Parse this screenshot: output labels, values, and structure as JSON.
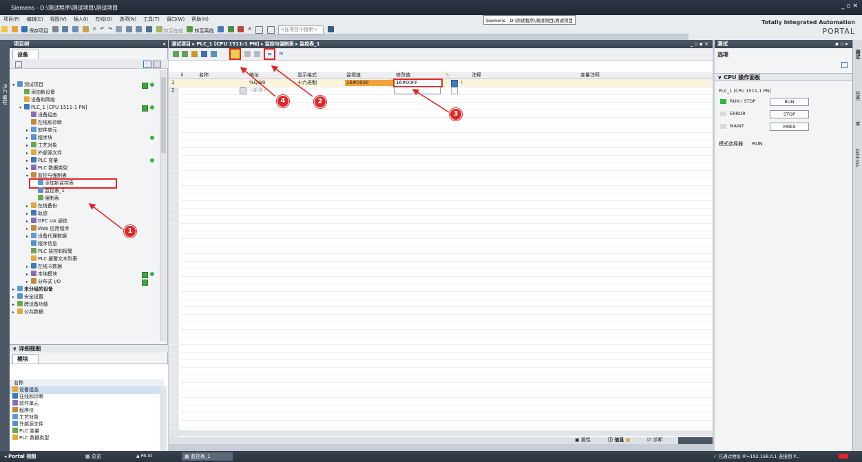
{
  "window": {
    "title": "Siemens - D:\\测试程序\\测试项目\\测试项目",
    "tooltip": "Siemens - D:\\测试程序\\测试项目\\测试项目",
    "brand_line1": "Totally Integrated Automation",
    "brand_line2": "PORTAL"
  },
  "menu": [
    "项目(P)",
    "编辑(E)",
    "视图(V)",
    "插入(I)",
    "在线(O)",
    "选项(N)",
    "工具(T)",
    "窗口(W)",
    "帮助(H)"
  ],
  "toolbar": {
    "save_label": "保存项目",
    "go_online": "转至在线",
    "go_offline": "转至离线",
    "search_placeholder": "<在项目中搜索>"
  },
  "project_tree": {
    "header": "项目树",
    "tab": "设备",
    "side_tab": "PLC 编程",
    "items": [
      {
        "label": "测试项目",
        "level": 0,
        "state": "expanded",
        "check": true,
        "dot": true
      },
      {
        "label": "添加新设备",
        "level": 1,
        "state": "none"
      },
      {
        "label": "设备和网络",
        "level": 1,
        "state": "none"
      },
      {
        "label": "PLC_1 [CPU 1511-1 PN]",
        "level": 1,
        "state": "expanded",
        "check": true,
        "dot": true
      },
      {
        "label": "设备组态",
        "level": 2,
        "state": "none"
      },
      {
        "label": "在线和诊断",
        "level": 2,
        "state": "none"
      },
      {
        "label": "软件单元",
        "level": 2,
        "state": "collapsed"
      },
      {
        "label": "程序块",
        "level": 2,
        "state": "collapsed",
        "dot": true
      },
      {
        "label": "工艺对象",
        "level": 2,
        "state": "collapsed"
      },
      {
        "label": "外部源文件",
        "level": 2,
        "state": "collapsed"
      },
      {
        "label": "PLC 变量",
        "level": 2,
        "state": "collapsed",
        "dot": true
      },
      {
        "label": "PLC 数据类型",
        "level": 2,
        "state": "collapsed"
      },
      {
        "label": "监控与强制表",
        "level": 2,
        "state": "expanded"
      },
      {
        "label": "添加新监控表",
        "level": 3,
        "state": "none",
        "selected": true
      },
      {
        "label": "监控表_1",
        "level": 3,
        "state": "none"
      },
      {
        "label": "强制表",
        "level": 3,
        "state": "none"
      },
      {
        "label": "在线备份",
        "level": 2,
        "state": "collapsed"
      },
      {
        "label": "轨迹",
        "level": 2,
        "state": "collapsed"
      },
      {
        "label": "OPC UA 通信",
        "level": 2,
        "state": "collapsed"
      },
      {
        "label": "Web 应用程序",
        "level": 2,
        "state": "collapsed"
      },
      {
        "label": "设备代理数据",
        "level": 2,
        "state": "collapsed"
      },
      {
        "label": "程序信息",
        "level": 2,
        "state": "none"
      },
      {
        "label": "PLC 监控和报警",
        "level": 2,
        "state": "none"
      },
      {
        "label": "PLC 报警文本列表",
        "level": 2,
        "state": "none"
      },
      {
        "label": "在线卡数据",
        "level": 2,
        "state": "collapsed"
      },
      {
        "label": "本地模块",
        "level": 2,
        "state": "collapsed",
        "check": true,
        "dot": true
      },
      {
        "label": "分布式 I/O",
        "level": 2,
        "state": "collapsed",
        "check": true
      },
      {
        "label": "未分组的设备",
        "level": 0,
        "state": "collapsed",
        "bold": true
      },
      {
        "label": "安全设置",
        "level": 0,
        "state": "collapsed"
      },
      {
        "label": "跨设备功能",
        "level": 0,
        "state": "collapsed"
      },
      {
        "label": "公共数据",
        "level": 0,
        "state": "collapsed"
      }
    ]
  },
  "detail_view": {
    "header": "详细视图",
    "tab": "模块",
    "col": "名称",
    "items": [
      "设备组态",
      "在线和诊断",
      "软件单元",
      "程序块",
      "工艺对象",
      "外部源文件",
      "PLC 变量",
      "PLC 数据类型"
    ]
  },
  "editor": {
    "breadcrumb": "测试项目 ▸ PLC_1 [CPU 1511-1 PN] ▸ 监控与强制表 ▸ 监控表_1",
    "columns": {
      "i": "i",
      "name": "名称",
      "address": "地址",
      "display": "显示格式",
      "monitor": "监视值",
      "modify": "修改值",
      "comment": "注释",
      "var_comment": "变量注释"
    },
    "rows": [
      {
        "num": "1",
        "name": "",
        "address": "%QW0",
        "display": "十六进制",
        "monitor": "16#0000",
        "modify": "16#00FF",
        "comment": "",
        "warn": "!"
      },
      {
        "num": "2",
        "name": "",
        "address": "<新增>",
        "display": "",
        "monitor": "",
        "modify": "",
        "comment": ""
      }
    ],
    "annotations": [
      "1",
      "2",
      "3",
      "4"
    ]
  },
  "bottom_tabs": {
    "props": "属性",
    "info": "信息",
    "diag": "诊断"
  },
  "right_panel": {
    "header": "测试",
    "options": "选项",
    "section": "CPU 操作面板",
    "device": "PLC_1 [CPU 1511-1 PN]",
    "leds": [
      {
        "label": "RUN / STOP",
        "button": "RUN",
        "color": "#2db83d"
      },
      {
        "label": "ERROR",
        "button": "STOP",
        "color": "#d7d9dc"
      },
      {
        "label": "MAINT",
        "button": "MRES",
        "color": "#d7d9dc"
      }
    ],
    "mode_label": "模式选择器：",
    "mode_value": "RUN",
    "side_tabs": [
      "测试",
      "任务",
      "库",
      "Add-ins"
    ]
  },
  "statusbar": {
    "portal": "Portal 视图",
    "overview": "总览",
    "pnio": "PN-IO",
    "table": "监控表_1",
    "connection": "已通过地址 IP=192.168.0.1 连接到 P..."
  }
}
